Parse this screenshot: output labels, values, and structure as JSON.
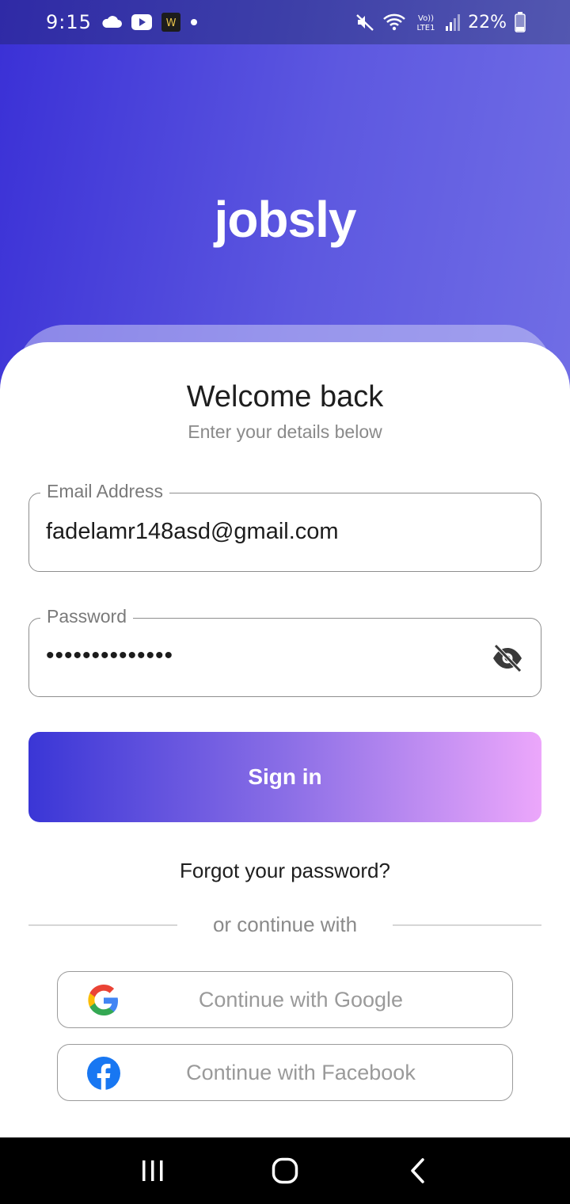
{
  "status_bar": {
    "time": "9:15",
    "battery": "22%",
    "left_icons": [
      "cloud-icon",
      "youtube-icon",
      "w-app-icon",
      "dot-icon"
    ],
    "right_icons": [
      "mute-icon",
      "wifi-icon",
      "volte-lte-icon",
      "signal-icon",
      "battery-icon"
    ],
    "network": "VoLTE1"
  },
  "app": {
    "title": "jobsly",
    "brand_gradient": [
      "#3a30d6",
      "#7a78e8"
    ]
  },
  "login": {
    "title": "Welcome back",
    "subtitle": "Enter your details below",
    "email": {
      "label": "Email Address",
      "value": "fadelamr148asd@gmail.com"
    },
    "password": {
      "label": "Password",
      "value": "••••••••••••••",
      "visibility_icon": "eye-off-icon"
    },
    "sign_in_label": "Sign in",
    "forgot_label": "Forgot your password?",
    "divider_label": "or continue with",
    "google_label": "Continue with Google",
    "facebook_label": "Continue with Facebook"
  },
  "nav": {
    "buttons": [
      "recent-apps-icon",
      "home-icon",
      "back-icon"
    ]
  }
}
